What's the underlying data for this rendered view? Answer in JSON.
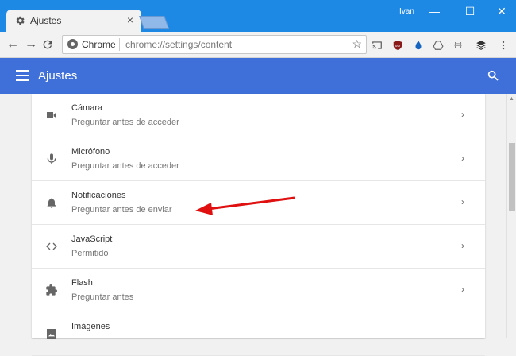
{
  "window": {
    "tab_title": "Ajustes",
    "tab_close": "×",
    "user_name": "Ivan",
    "minimize": "—",
    "maximize": "☐",
    "close": "✕"
  },
  "toolbar": {
    "back": "←",
    "forward": "→",
    "reload": "C",
    "site_name": "Chrome",
    "url": "chrome://settings/content",
    "bookmark": "☆",
    "extensions": [
      "cast-icon",
      "ublock-icon",
      "drop-icon",
      "drive-icon",
      "json-icon",
      "layers-icon",
      "menu-dots-icon"
    ]
  },
  "header": {
    "title": "Ajustes"
  },
  "settings": {
    "items": [
      {
        "title": "Cámara",
        "subtitle": "Preguntar antes de acceder",
        "icon": "camera-icon"
      },
      {
        "title": "Micrófono",
        "subtitle": "Preguntar antes de acceder",
        "icon": "microphone-icon"
      },
      {
        "title": "Notificaciones",
        "subtitle": "Preguntar antes de enviar",
        "icon": "bell-icon"
      },
      {
        "title": "JavaScript",
        "subtitle": "Permitido",
        "icon": "code-icon"
      },
      {
        "title": "Flash",
        "subtitle": "Preguntar antes",
        "icon": "puzzle-icon"
      },
      {
        "title": "Imágenes",
        "subtitle": "",
        "icon": "image-icon"
      }
    ],
    "arrow": "›"
  },
  "colors": {
    "titlebar": "#1e88e5",
    "header": "#3f6fd8",
    "annotation_arrow": "#e01010"
  }
}
